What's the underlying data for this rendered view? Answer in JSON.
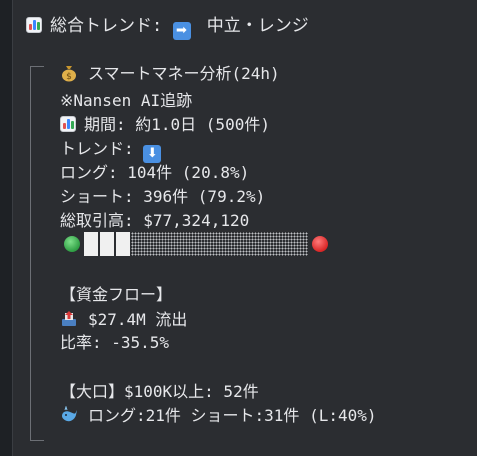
{
  "header": {
    "icon": "bar-chart-icon",
    "label": "総合トレンド:",
    "arrow_icon": "right-arrow-icon",
    "arrow": "➡",
    "value": "中立・レンジ"
  },
  "section": {
    "icon": "money-bag-icon",
    "title": "スマートマネー分析(24h)",
    "source": "※Nansen AI追跡",
    "period_icon": "bar-chart-icon",
    "period": "期間: 約1.0日 (500件)",
    "trend_label": "トレンド:",
    "trend_icon": "down-arrow-icon",
    "trend_arrow": "⬇",
    "long": "ロング: 104件 (20.8%)",
    "short": "ショート: 396件 (79.2%)",
    "volume": "総取引高: $77,324,120",
    "long_ratio": 0.208,
    "colors": {
      "long": "#2f9e44",
      "short": "#d92626"
    }
  },
  "flow": {
    "title": "【資金フロー】",
    "icon": "outbox-tray-icon",
    "amount": "$27.4M 流出",
    "ratio": "比率: -35.5%"
  },
  "large": {
    "title": "【大口】$100K以上: 52件",
    "icon": "whale-icon",
    "detail": "ロング:21件 ショート:31件 (L:40%)"
  }
}
